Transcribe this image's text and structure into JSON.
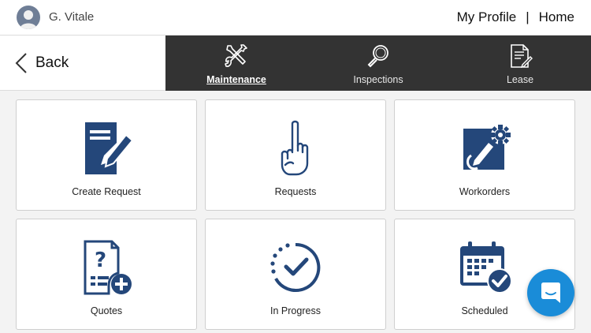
{
  "header": {
    "user_name": "G. Vitale",
    "my_profile_label": "My Profile",
    "separator": "|",
    "home_label": "Home"
  },
  "back": {
    "label": "Back"
  },
  "tabs": [
    {
      "label": "Maintenance",
      "icon": "tools-icon",
      "active": true
    },
    {
      "label": "Inspections",
      "icon": "magnifier-icon",
      "active": false
    },
    {
      "label": "Lease",
      "icon": "document-pen-icon",
      "active": false
    }
  ],
  "tiles": [
    {
      "label": "Create Request",
      "icon": "create-request-icon"
    },
    {
      "label": "Requests",
      "icon": "raised-finger-icon"
    },
    {
      "label": "Workorders",
      "icon": "workorder-gear-icon"
    },
    {
      "label": "Quotes",
      "icon": "quote-question-icon"
    },
    {
      "label": "In Progress",
      "icon": "progress-check-icon"
    },
    {
      "label": "Scheduled",
      "icon": "calendar-check-icon"
    }
  ],
  "colors": {
    "icon_navy": "#24477a",
    "tabbar_bg": "#333333",
    "chat_blue": "#1a8cd8"
  }
}
